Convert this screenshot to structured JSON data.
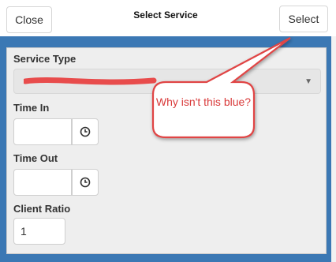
{
  "header": {
    "close_label": "Close",
    "title": "Select Service",
    "select_label": "Select"
  },
  "form": {
    "service_type_label": "Service Type",
    "time_in_label": "Time In",
    "time_out_label": "Time Out",
    "client_ratio_label": "Client Ratio",
    "client_ratio_value": "1"
  },
  "annotation": {
    "text": "Why isn't this blue?"
  },
  "icons": {
    "caret": "chevron-down-icon",
    "time": "clock-icon"
  },
  "colors": {
    "frame": "#3b78b4",
    "annotation": "#e04545"
  }
}
